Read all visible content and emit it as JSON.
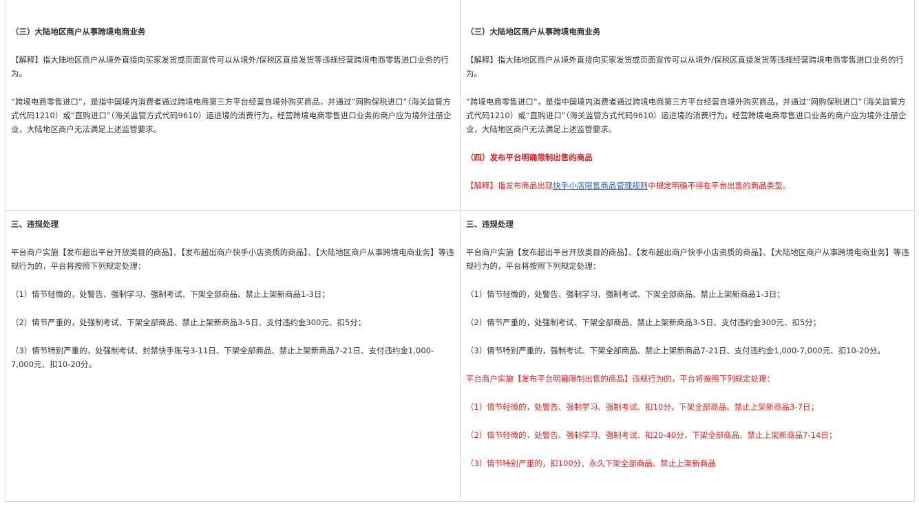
{
  "left_top": {
    "heading": "（三）大陆地区商户从事跨境电商业务",
    "explain": "【解释】指大陆地区商户从境外直接向买家发货或页面宣传可以从境外/保税区直接发货等违规经营跨境电商零售进口业务的行为。",
    "definition": "“跨境电商零售进口”，是指中国境内消费者通过跨境电商第三方平台经营自境外购买商品，并通过“网购保税进口”（海关监管方式代码1210）或“直购进口”（海关监管方式代码9610）运进境的消费行为。经营跨境电商零售进口业务的商户应为境外注册企业，大陆地区商户无法满足上述监管要求。"
  },
  "right_top": {
    "heading": "（三）大陆地区商户从事跨境电商业务",
    "explain": "【解释】指大陆地区商户从境外直接向买家发货或页面宣传可以从境外/保税区直接发货等违规经营跨境电商零售进口业务的行为。",
    "definition": "“跨境电商零售进口”，是指中国境内消费者通过跨境电商第三方平台经营自境外购买商品，并通过“网购保税进口”（海关监管方式代码1210）或“直购进口”（海关监管方式代码9610）运进境的消费行为。经营跨境电商零售进口业务的商户应为境外注册企业，大陆地区商户无法满足上述监管要求。",
    "heading4": "（四）发布平台明确限制出售的商品",
    "explain4_prefix": "【解释】指发布商品出现",
    "explain4_link": "快手小店限售商品管理规则",
    "explain4_suffix": "中规定明确不得在平台出售的商品类型。"
  },
  "left_bottom": {
    "heading": "三、违规处理",
    "intro": "平台商户实施【发布超出平台开放类目的商品】、【发布超出商户快手小店资质的商品】、【大陆地区商户从事跨境电商业务】等违规行为的，平台将按照下列规定处理：",
    "items": [
      "（1）情节轻微的，处警告、强制学习、强制考试、下架全部商品、禁止上架新商品1-3日；",
      "（2）情节严重的，处强制考试、下架全部商品、禁止上架新商品3-5日、支付违约金300元、扣5分；",
      "（3）情节特别严重的，处强制考试、封禁快手账号3-11日、下架全部商品、禁止上架新商品7-21日、支付违约金1,000-7,000元、扣10-20分。"
    ]
  },
  "right_bottom": {
    "heading": "三、违规处理",
    "intro": "平台商户实施【发布超出平台开放类目的商品】、【发布超出商户快手小店资质的商品】、【大陆地区商户从事跨境电商业务】等违规行为的，平台将按照下列规定处理：",
    "items": [
      "（1）情节轻微的，处警告、强制学习、强制考试、下架全部商品、禁止上架新商品1-3日；",
      "（2）情节严重的，处强制考试、下架全部商品、禁止上架新商品3-5日、支付违约金300元、扣5分；",
      "（3）情节特别严重的，强制考试、下架全部商品、禁止上架新商品7-21日、支付违约金1,000-7,000元、扣10-20分。"
    ],
    "red_intro": "平台商户实施【发布平台明确限制出售的商品】违规行为的，平台将按照下列规定处理：",
    "red_items": [
      "（1）情节轻微的，处警告、强制学习、强制考试、扣10分、下架全部商品、禁止上架新商品3-7日；",
      "（2）情节轻微的，处警告、强制学习、强制考试、扣20-40分，下架全部商品、禁止上架新商品7-14日；",
      "（3）情节特别严重的，扣100分、永久下架全部商品、禁止上架新商品"
    ]
  },
  "colors": {
    "text": "#333333",
    "red": "#e02020",
    "link": "#2a62c9",
    "border": "#d9d9d9"
  }
}
